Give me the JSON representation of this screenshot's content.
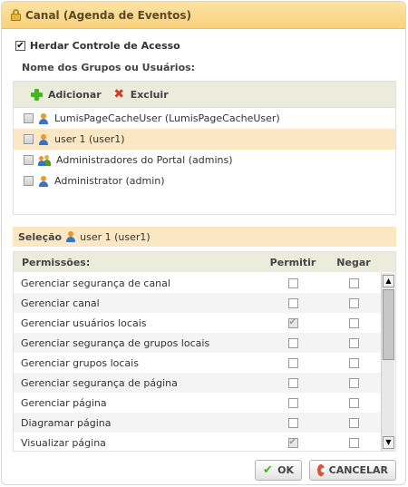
{
  "dialog": {
    "title": "Canal (Agenda de Eventos)",
    "inherit_label": "Herdar Controle de Acesso",
    "inherit_checked": true,
    "groups_label": "Nome dos Grupos ou Usuários:"
  },
  "toolbar": {
    "add_label": "Adicionar",
    "delete_label": "Excluir"
  },
  "groups": [
    {
      "label": "LumisPageCacheUser (LumisPageCacheUser)",
      "icon": "user-icon",
      "selected": false
    },
    {
      "label": "user 1 (user1)",
      "icon": "user-icon",
      "selected": true
    },
    {
      "label": "Administradores do Portal (admins)",
      "icon": "users-icon",
      "selected": false
    },
    {
      "label": "Administrator (admin)",
      "icon": "user-icon",
      "selected": false
    }
  ],
  "selection": {
    "label": "Seleção",
    "user": "user 1 (user1)"
  },
  "permissions": {
    "header_name": "Permissões:",
    "header_allow": "Permitir",
    "header_deny": "Negar",
    "rows": [
      {
        "name": "Gerenciar segurança de canal",
        "allow": false,
        "deny": false
      },
      {
        "name": "Gerenciar canal",
        "allow": false,
        "deny": false
      },
      {
        "name": "Gerenciar usuários locais",
        "allow": true,
        "deny": false
      },
      {
        "name": "Gerenciar segurança de grupos locais",
        "allow": false,
        "deny": false
      },
      {
        "name": "Gerenciar grupos locais",
        "allow": false,
        "deny": false
      },
      {
        "name": "Gerenciar segurança de página",
        "allow": false,
        "deny": false
      },
      {
        "name": "Gerenciar página",
        "allow": false,
        "deny": false
      },
      {
        "name": "Diagramar página",
        "allow": false,
        "deny": false
      },
      {
        "name": "Visualizar página",
        "allow": true,
        "deny": false
      }
    ]
  },
  "buttons": {
    "ok_label": "OK",
    "cancel_label": "CANCELAR"
  },
  "colors": {
    "title_bar": "#f9d27c",
    "selection_highlight": "#fbe7c4",
    "toolbar_bg": "#ececdc"
  }
}
